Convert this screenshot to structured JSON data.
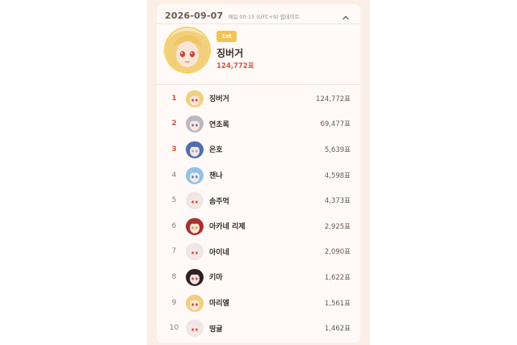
{
  "header": {
    "date": "2026-09-07",
    "update_note": "매일 00:15 (UTC+9) 업데이트"
  },
  "top": {
    "badge": "1st",
    "name": "징버거",
    "votes": "124,772표"
  },
  "colors": {
    "accent": "#d2553b",
    "badge": "#f3c455",
    "panel": "#fbeee6",
    "card": "#fffaf7"
  },
  "ranking": [
    {
      "rank": "1",
      "name": "징버거",
      "votes": "124,772표",
      "avatar": "blonde-hair-avatar"
    },
    {
      "rank": "2",
      "name": "연초록",
      "votes": "69,477표",
      "avatar": "gray-hair-avatar"
    },
    {
      "rank": "3",
      "name": "은호",
      "votes": "5,639표",
      "avatar": "blue-hair-avatar"
    },
    {
      "rank": "4",
      "name": "챈나",
      "votes": "4,598표",
      "avatar": "light-blue-hair-avatar"
    },
    {
      "rank": "5",
      "name": "솜주먹",
      "votes": "4,373표",
      "avatar": "white-hair-avatar"
    },
    {
      "rank": "6",
      "name": "아카네 리제",
      "votes": "2,925표",
      "avatar": "red-hair-avatar"
    },
    {
      "rank": "7",
      "name": "아이네",
      "votes": "2,090표",
      "avatar": "white-hair-avatar"
    },
    {
      "rank": "8",
      "name": "키마",
      "votes": "1,622표",
      "avatar": "dark-hair-avatar"
    },
    {
      "rank": "9",
      "name": "마리엘",
      "votes": "1,561표",
      "avatar": "blonde-hair-avatar"
    },
    {
      "rank": "10",
      "name": "띵귤",
      "votes": "1,462표",
      "avatar": "white-hair-avatar"
    }
  ]
}
